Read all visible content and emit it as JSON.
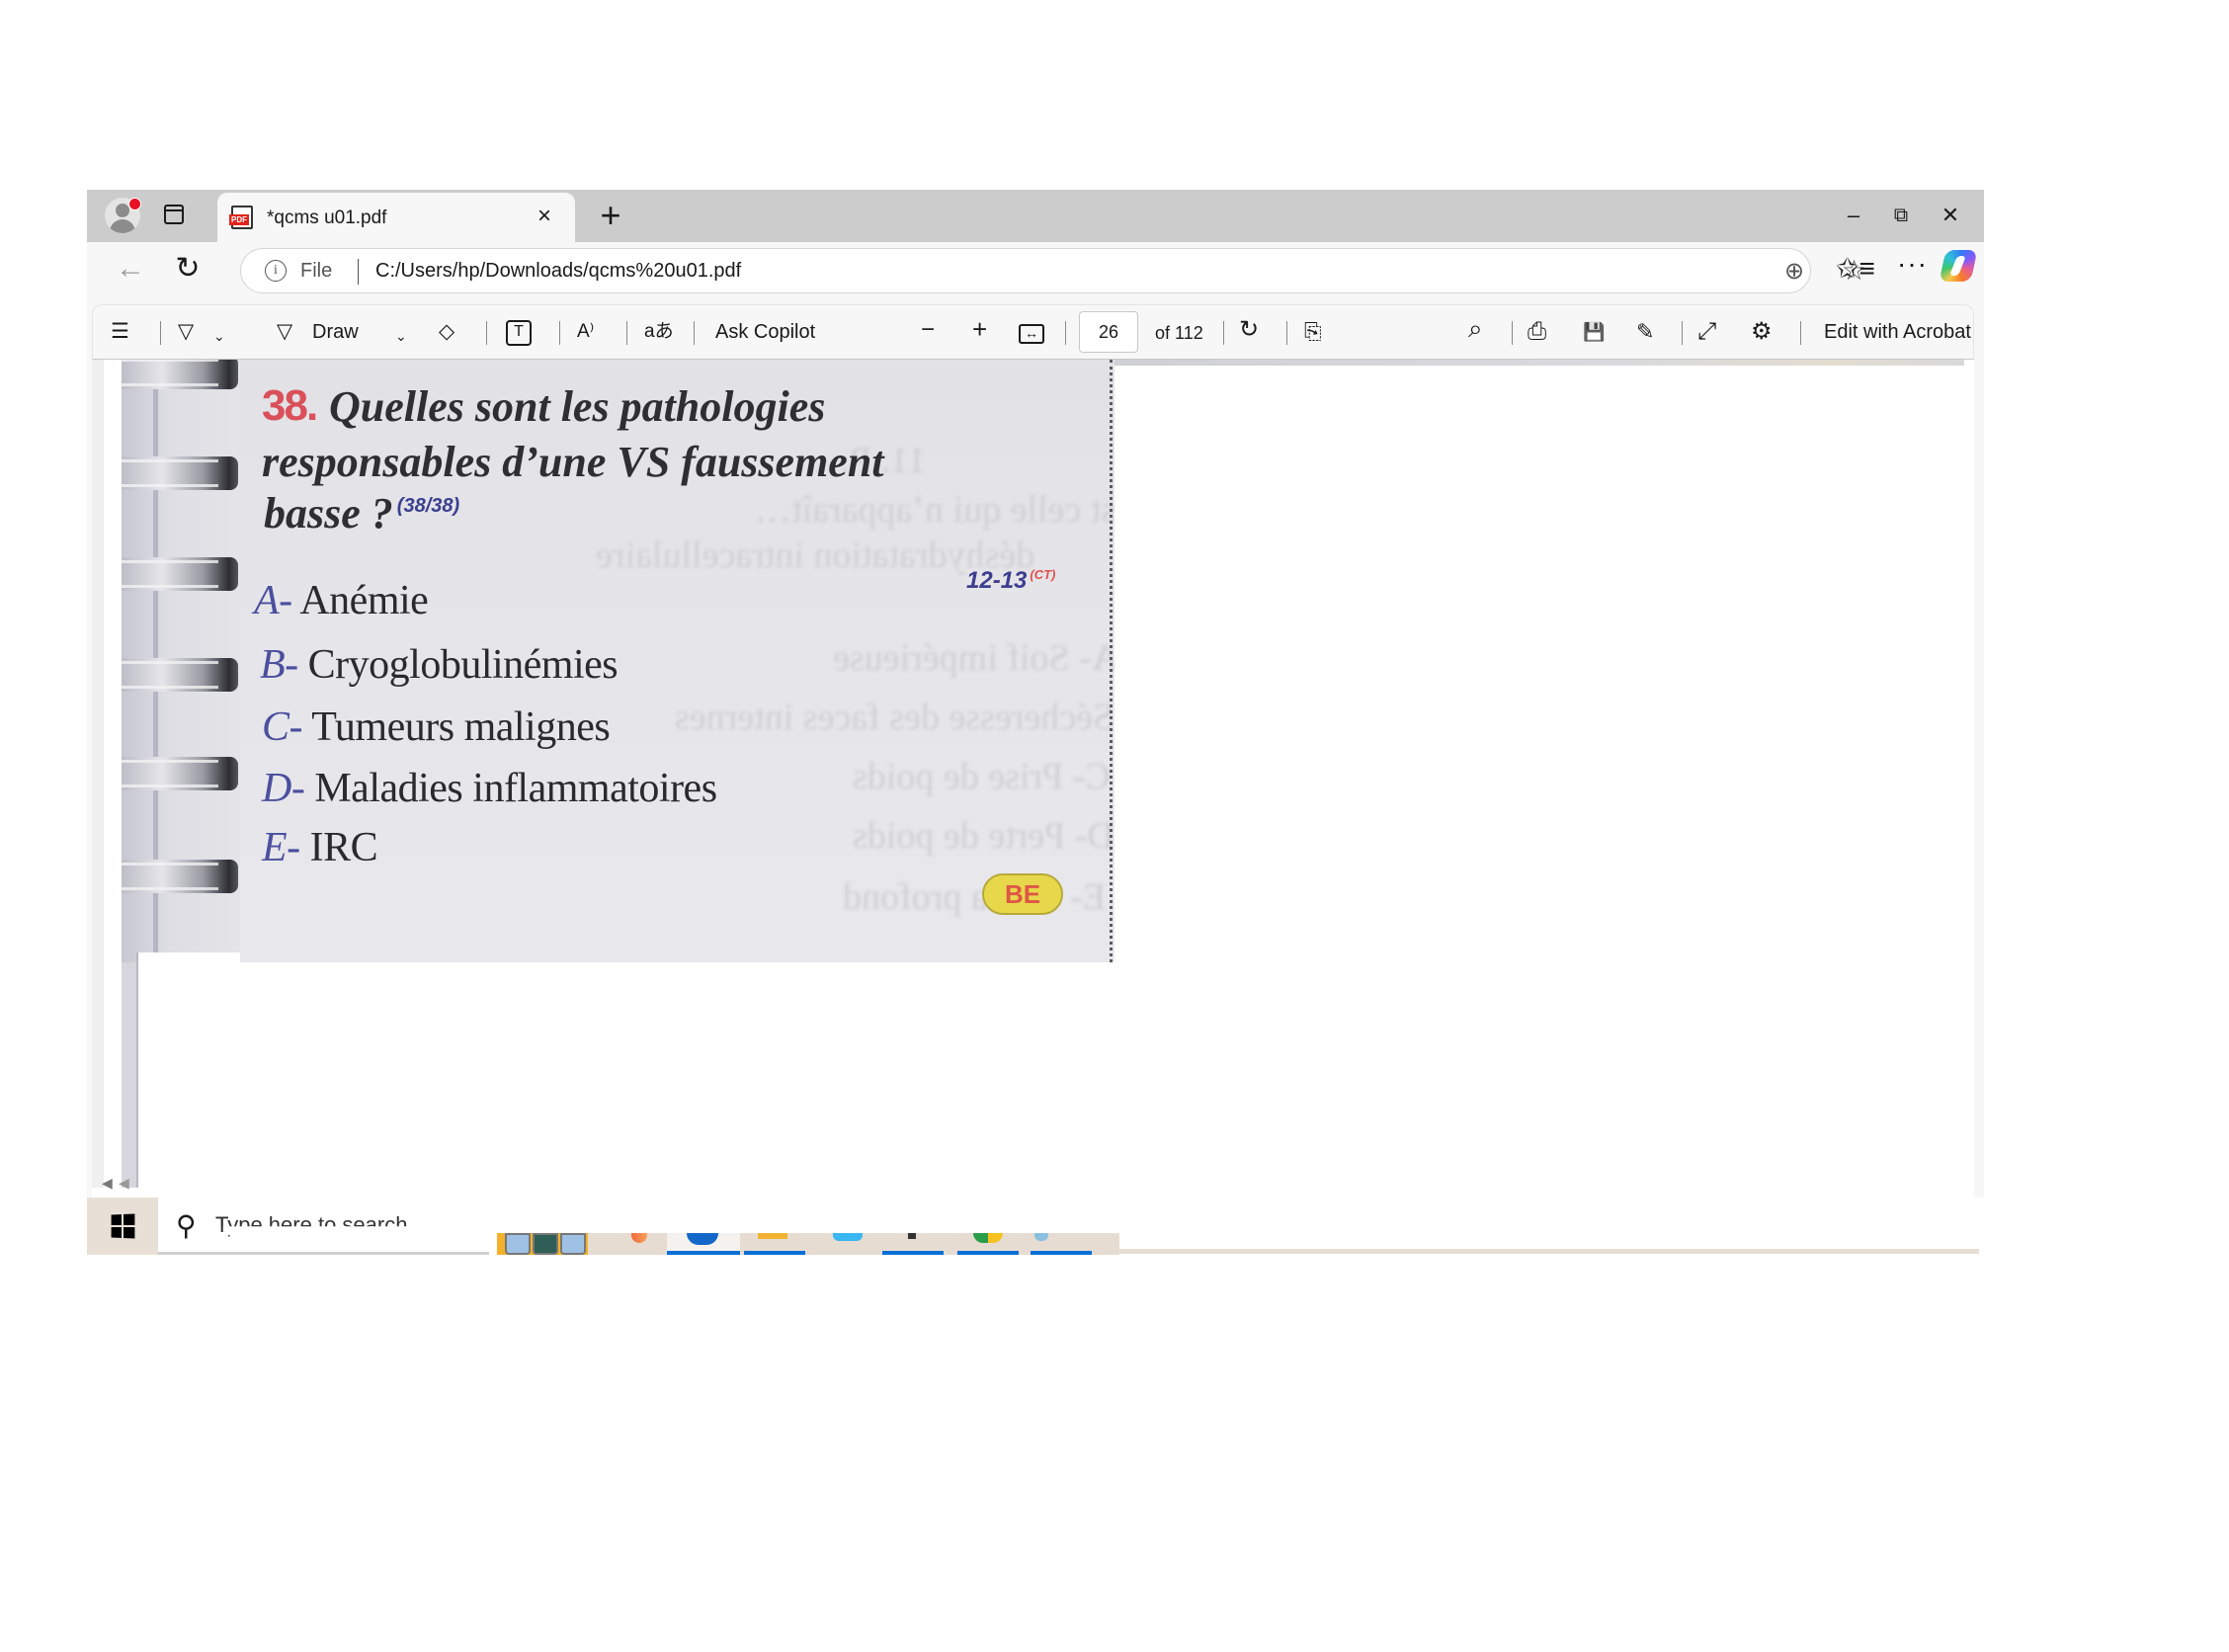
{
  "browser": {
    "tab": {
      "title": "*qcms u01.pdf",
      "favicon_label": "PDF",
      "close_glyph": "×"
    },
    "new_tab_glyph": "+",
    "window_controls": {
      "minimize": "–",
      "restore": "⧉",
      "close": "✕"
    },
    "address": {
      "back_glyph": "←",
      "refresh_glyph": "↻",
      "scheme_label": "File",
      "url": "C:/Users/hp/Downloads/qcms%20u01.pdf",
      "info_glyph": "i",
      "zoom_glyph": "⊕",
      "star_glyph": "☆",
      "favorites_glyph": "✩≡",
      "more_glyph": "···"
    }
  },
  "pdf_toolbar": {
    "contents_glyph": "☰",
    "highlight_glyph": "▽",
    "draw_label": "Draw",
    "draw_glyph": "▽",
    "chevron": "⌄",
    "erase_glyph": "◇",
    "textbox_glyph": "T",
    "read_aloud_glyph": "A⁾",
    "translate_glyph": "aあ",
    "ask_copilot": "Ask Copilot",
    "zoom_out": "−",
    "zoom_in": "+",
    "fit_glyph": "↔",
    "page_current": "26",
    "page_total_label": "of 112",
    "rotate_glyph": "↻",
    "page_view_glyph": "⎘",
    "search_glyph": "⌕",
    "print_glyph": "⎙",
    "save_glyph": "💾",
    "save_as_glyph": "✎",
    "fullscreen_glyph": "⤢",
    "settings_glyph": "⚙",
    "edit_acrobat": "Edit with Acrobat"
  },
  "document": {
    "question_number": "38.",
    "question_lines": [
      "Quelles sont les pathologies",
      "responsables d’une VS faussement",
      "basse ?"
    ],
    "question_ref": "(38/38)",
    "pages_ref": "12-13",
    "pages_ref_sup": "(CT)",
    "options": [
      {
        "letter": "A-",
        "text": "Anémie"
      },
      {
        "letter": "B-",
        "text": "Cryoglobulinémies"
      },
      {
        "letter": "C-",
        "text": "Tumeurs malignes"
      },
      {
        "letter": "D-",
        "text": "Maladies inflammatoires"
      },
      {
        "letter": "E-",
        "text": "IRC"
      }
    ],
    "badge": "BE",
    "bleed_through": [
      "11. P…",
      "quelle est celle qui n’apparaît…",
      "déshydratation intracellulaire",
      "A- Soif impérieuse",
      "B- Sécheresse des faces internes",
      "C- Prise de poids",
      "D- Perte de poids",
      "E- Coma profond"
    ]
  },
  "taskbar": {
    "search_placeholder": "Type here to search",
    "search_glyph": "⚲"
  },
  "colors": {
    "question_number": "#d9505a",
    "option_letter": "#4b4f9e",
    "badge_fill": "#e6d84a",
    "badge_text": "#e05546",
    "taskbar_indicator": "#0a6fd6"
  }
}
